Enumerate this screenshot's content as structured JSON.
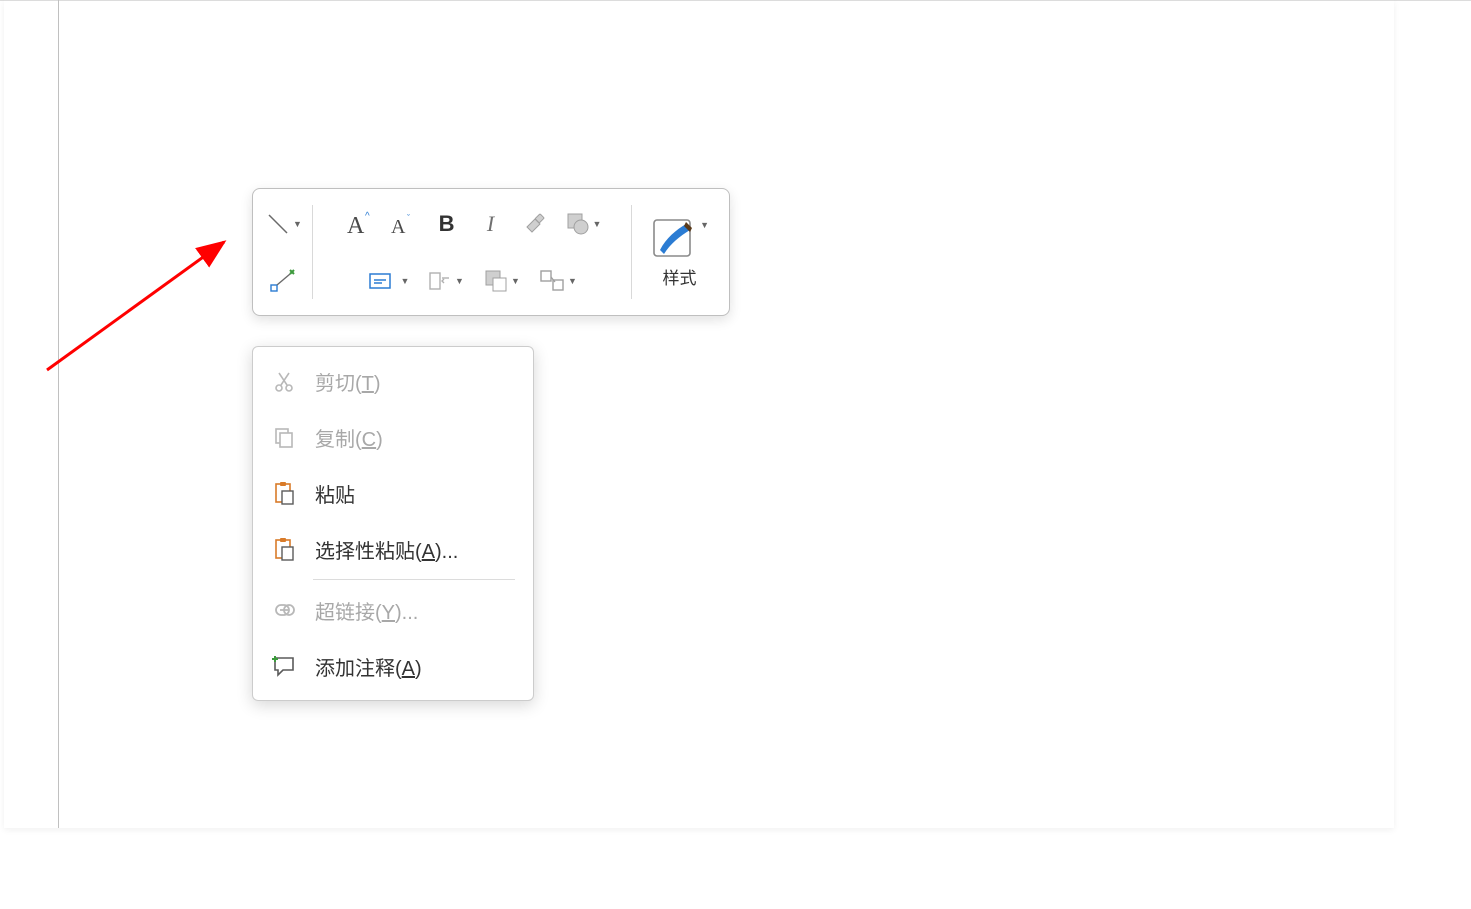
{
  "toolbar": {
    "styles_label": "样式",
    "bold_glyph": "B",
    "italic_glyph": "I"
  },
  "context_menu": {
    "cut": {
      "label": "剪切(",
      "mnemonic": "T",
      "suffix": ")",
      "enabled": false
    },
    "copy": {
      "label": "复制(",
      "mnemonic": "C",
      "suffix": ")",
      "enabled": false
    },
    "paste": {
      "label": "粘贴",
      "enabled": true
    },
    "paste_special": {
      "label": "选择性粘贴(",
      "mnemonic": "A",
      "suffix": ")...",
      "enabled": true
    },
    "hyperlink": {
      "label": "超链接(",
      "mnemonic": "Y",
      "suffix": ")...",
      "enabled": false
    },
    "add_comment": {
      "label": "添加注释(",
      "mnemonic": "A",
      "suffix": ")",
      "enabled": true
    }
  },
  "colors": {
    "accent_blue": "#2b7cd3",
    "accent_orange": "#d97b29",
    "disabled": "#a8a8a8"
  }
}
